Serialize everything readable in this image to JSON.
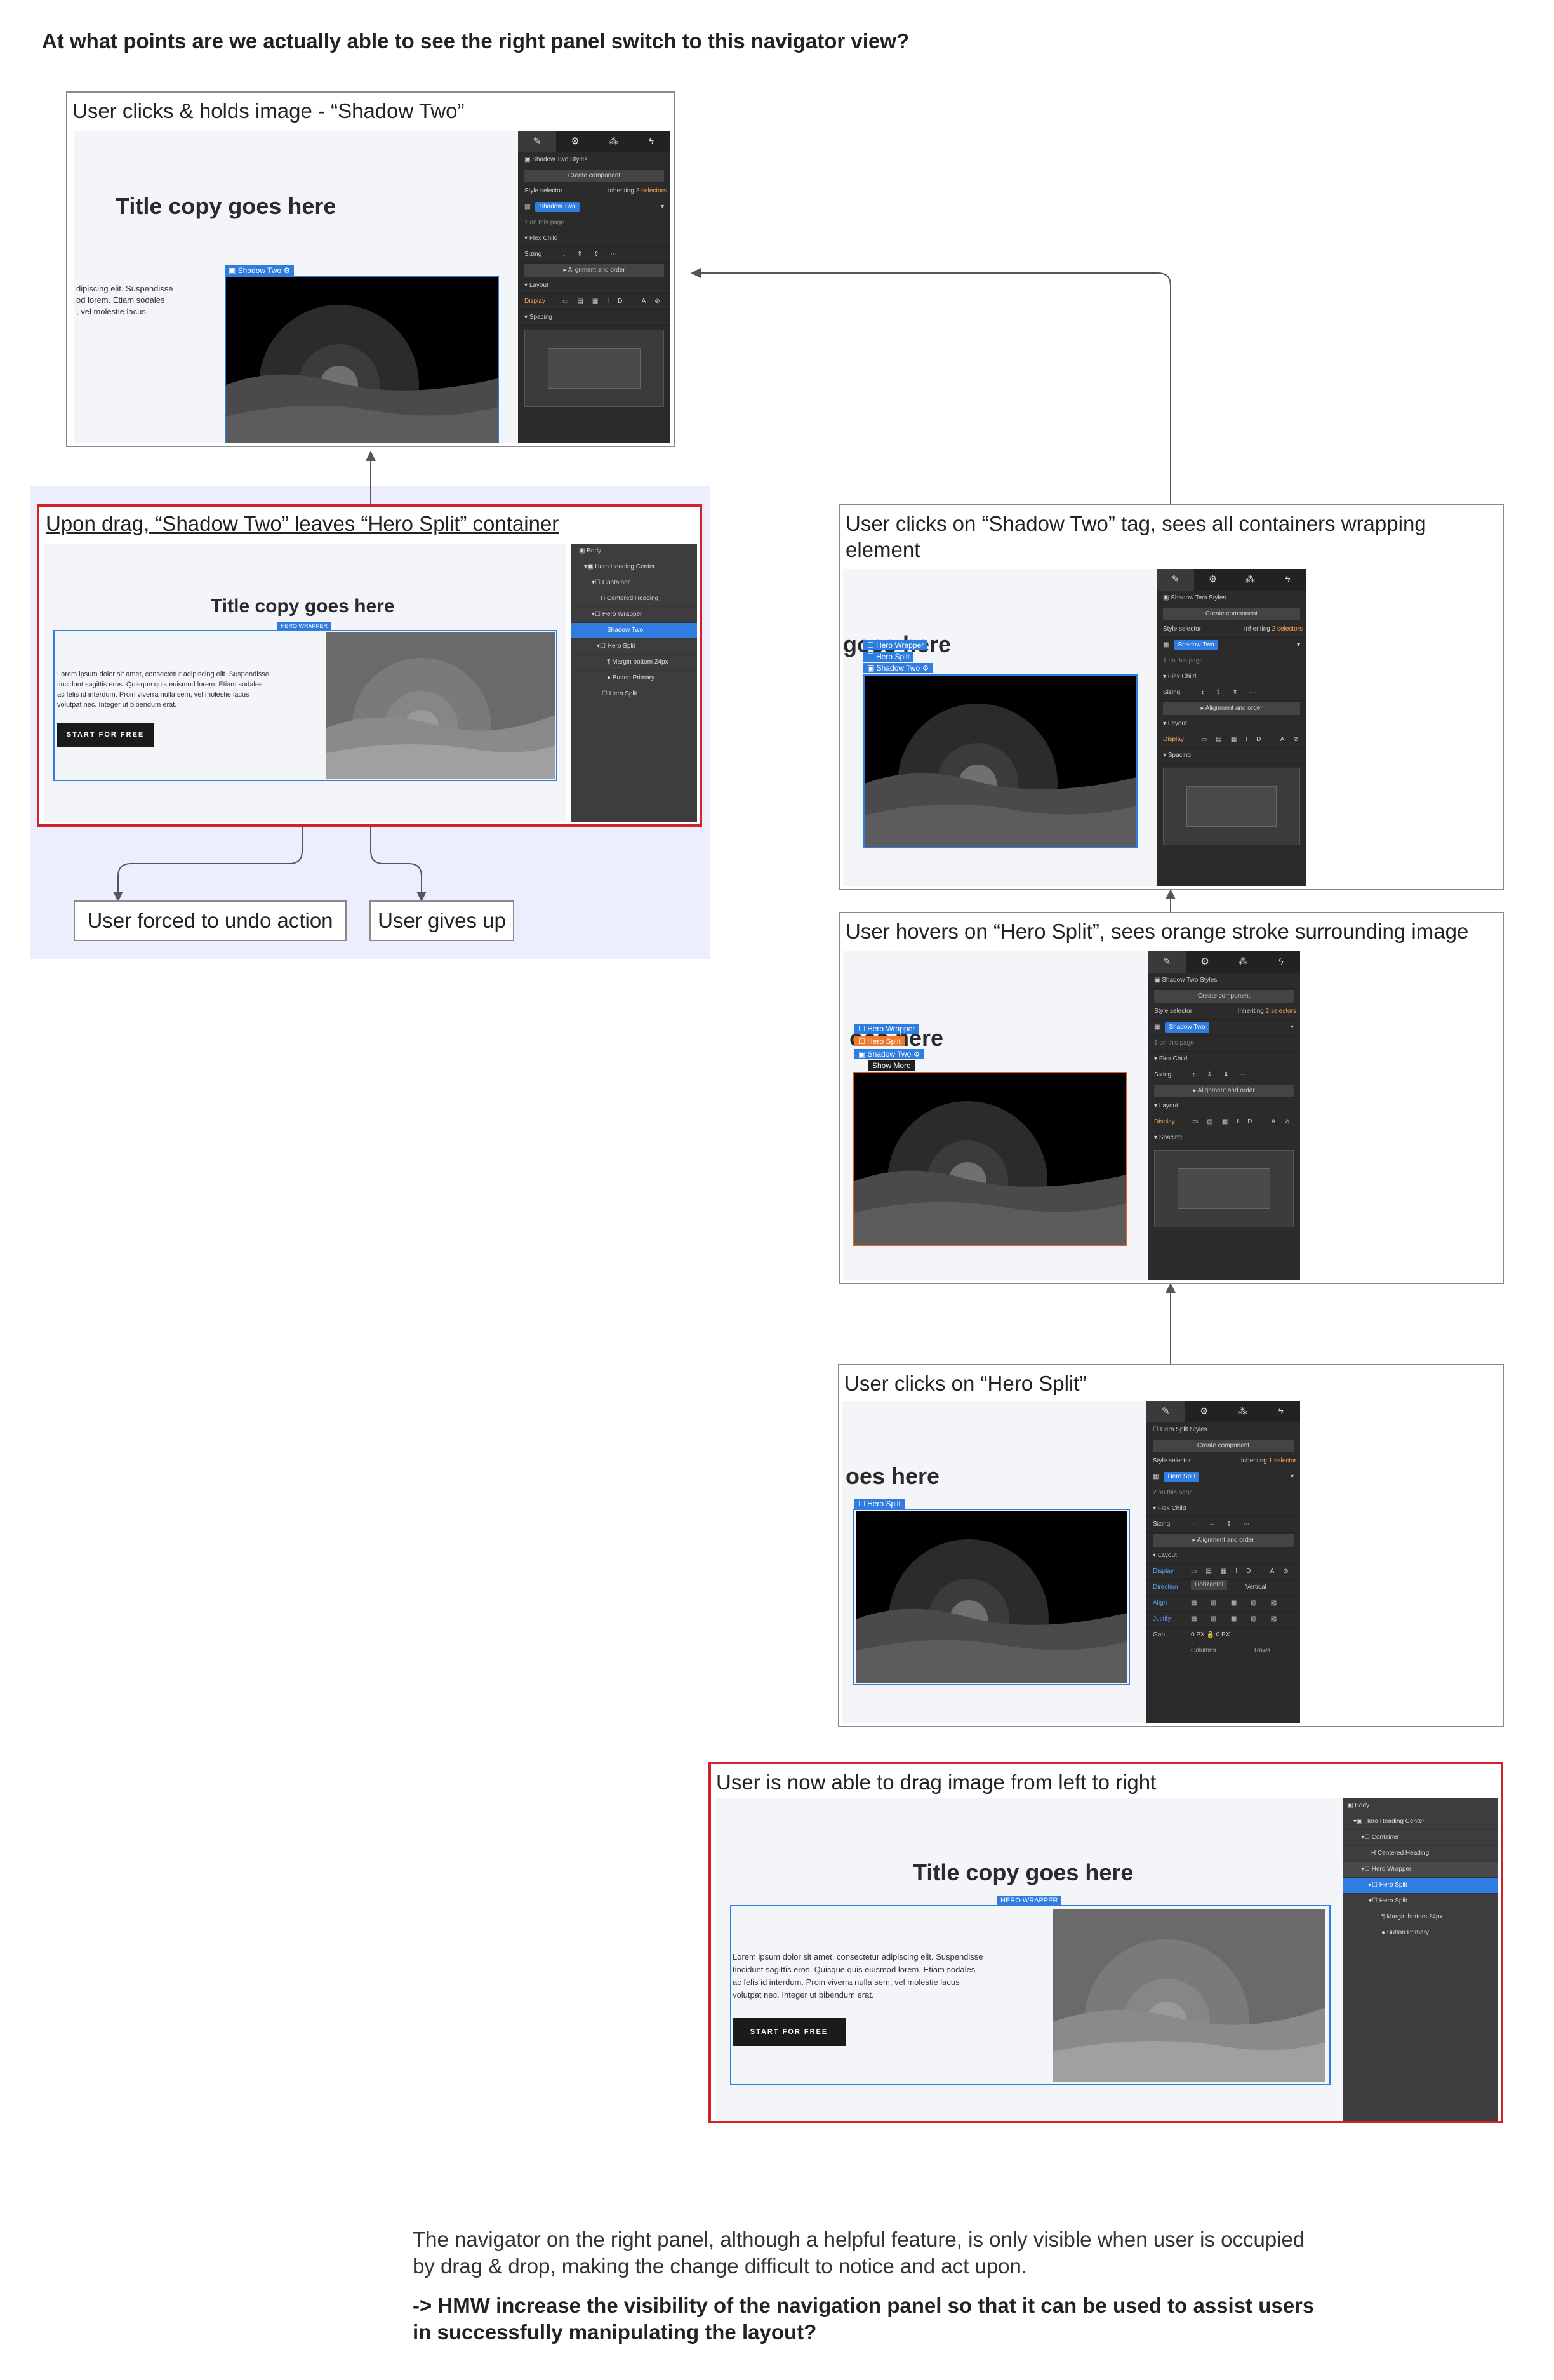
{
  "question": "At what points are we actually able to see the right panel switch to this navigator view?",
  "colors": {
    "selection_blue": "#2f7de1",
    "hover_orange": "#f07a2c",
    "callout_red": "#d3232a",
    "zone_lavender": "#ecedfd"
  },
  "steps": {
    "s1": {
      "label": "User clicks & holds image - “Shadow Two”",
      "title": "Title copy goes here",
      "tag": "Shadow Two",
      "copy": "dipiscing elit. Suspendisse\nod lorem. Etiam sodales\n, vel molestie lacus"
    },
    "s2": {
      "label": "Upon drag, “Shadow Two” leaves “Hero Split” container",
      "title": "Title copy goes here",
      "tag": "HERO WRAPPER",
      "copy": "Lorem ipsum dolor sit amet, consectetur adipiscing elit. Suspendisse\ntincidunt sagittis eros. Quisque quis euismod lorem. Etiam sodales\nac felis id interdum. Proin viverra nulla sem, vel molestie lacus\nvolutpat nec. Integer ut bibendum erat.",
      "button": "START FOR FREE"
    },
    "s3": {
      "label": "User clicks on “Shadow Two” tag, sees all containers wrapping element",
      "title": "goes here",
      "tags": [
        "Hero Wrapper",
        "Hero Split",
        "Shadow Two"
      ]
    },
    "s4": {
      "label": "User hovers on “Hero Split”, sees orange stroke surrounding image",
      "title": "oes here",
      "tags": [
        "Hero Wrapper",
        "Hero Split",
        "Shadow Two"
      ],
      "tooltip": "Show More"
    },
    "s5": {
      "label": "User clicks on “Hero Split”",
      "title": "oes here",
      "tag": "Hero Split"
    },
    "s6": {
      "label": "User is now able to drag image from left to right",
      "title": "Title copy goes here",
      "tag": "HERO WRAPPER",
      "copy": "Lorem ipsum dolor sit amet, consectetur adipiscing elit. Suspendisse\ntincidunt sagittis eros. Quisque quis euismod lorem. Etiam sodales\nac felis id interdum. Proin viverra nulla sem, vel molestie lacus\nvolutpat nec. Integer ut bibendum erat.",
      "button": "START FOR FREE"
    }
  },
  "outcomes": {
    "undo": "User forced to undo action",
    "give_up": "User gives up"
  },
  "panel": {
    "shadow_styles": "Shadow Two Styles",
    "hero_styles": "Hero Split Styles",
    "create": "Create component",
    "style_selector": "Style selector",
    "inheriting": "Inheriting",
    "two_selectors": "2 selectors",
    "one_selector": "1 selector",
    "chip_shadow": "Shadow Two",
    "chip_hero": "Hero Split",
    "on_page_1": "1 on this page",
    "on_page_2": "2 on this page",
    "flex_child": "Flex Child",
    "sizing": "Sizing",
    "align_order": "Alignment and order",
    "layout": "Layout",
    "display": "Display",
    "spacing": "Spacing",
    "margin": "MARGIN",
    "padding": "PADDING",
    "zero": "0",
    "direction": "Direction",
    "horizontal": "Horizontal",
    "vertical": "Vertical",
    "align": "Align",
    "justify": "Justify",
    "gap": "Gap",
    "columns": "Columns",
    "rows": "Rows",
    "px": "PX"
  },
  "navigator": {
    "s2": [
      "Body",
      "Hero Heading Center",
      "Container",
      "Centered Heading",
      "Hero Wrapper",
      "Shadow Two",
      "Hero Split",
      "Margin bottom 24px",
      "Button Primary",
      "Hero Split"
    ],
    "s6": [
      "Body",
      "Hero Heading Center",
      "Container",
      "Centered Heading",
      "Hero Wrapper",
      "Hero Split",
      "Hero Split",
      "Margin bottom 24px",
      "Button Primary"
    ]
  },
  "conclusion": {
    "text": "The navigator on the right panel, although a helpful feature, is only visible when user is occupied by drag & drop, making the change difficult to notice and act upon.",
    "hmw": "-> HMW increase the visibility of the navigation panel so that it can be used to assist users in successfully manipulating the layout?"
  }
}
